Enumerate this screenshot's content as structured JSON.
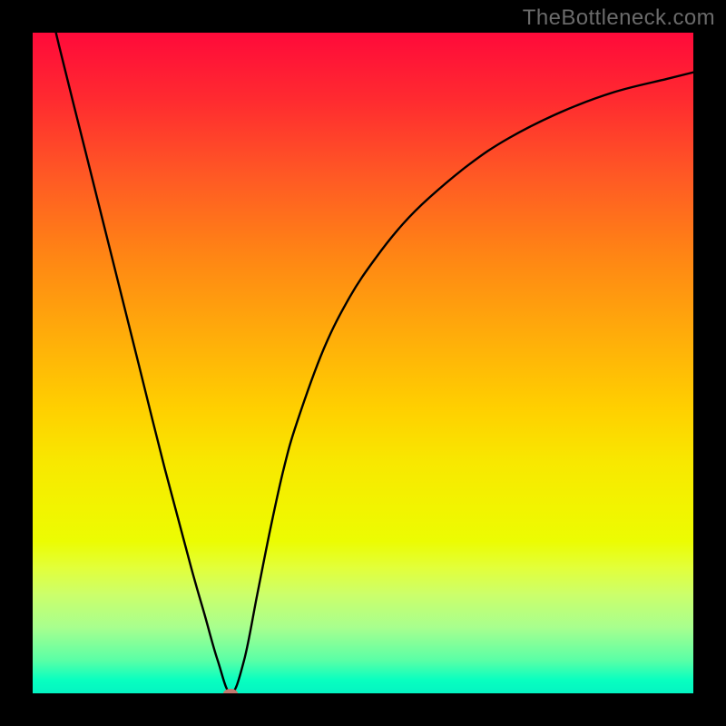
{
  "branding": "TheBottleneck.com",
  "chart_data": {
    "type": "line",
    "title": "",
    "xlabel": "",
    "ylabel": "",
    "xlim": [
      0,
      100
    ],
    "ylim": [
      0,
      100
    ],
    "series": [
      {
        "name": "bottleneck-curve",
        "x": [
          0,
          4,
          8,
          12,
          16,
          20,
          24,
          26,
          28,
          30,
          32,
          34,
          36,
          38,
          40,
          44,
          48,
          52,
          56,
          60,
          66,
          72,
          80,
          88,
          96,
          100
        ],
        "values": [
          115,
          98,
          82,
          66,
          50,
          34,
          19,
          12,
          5,
          0,
          5,
          15,
          25,
          34,
          41,
          52,
          60,
          66,
          71,
          75,
          80,
          84,
          88,
          91,
          93,
          94
        ]
      }
    ],
    "annotations": [
      {
        "name": "optimum-marker",
        "x": 30,
        "y": 0
      }
    ],
    "background": {
      "type": "gradient",
      "stops": [
        {
          "pos": 0.0,
          "color": "#ff0a3a"
        },
        {
          "pos": 0.5,
          "color": "#ffc400"
        },
        {
          "pos": 0.8,
          "color": "#eaff30"
        },
        {
          "pos": 1.0,
          "color": "#04f4c2"
        }
      ]
    }
  }
}
